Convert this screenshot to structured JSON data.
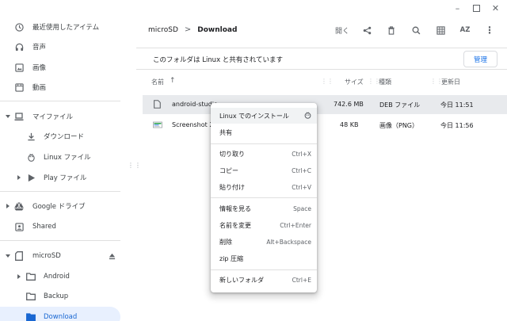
{
  "sidebar": {
    "items": [
      {
        "label": "最近使用したアイテム",
        "icon": "clock-icon"
      },
      {
        "label": "音声",
        "icon": "headphones-icon"
      },
      {
        "label": "画像",
        "icon": "image-icon"
      },
      {
        "label": "動画",
        "icon": "video-icon"
      },
      {
        "label": "マイファイル",
        "icon": "laptop-icon"
      },
      {
        "label": "ダウンロード",
        "icon": "download-icon"
      },
      {
        "label": "Linux ファイル",
        "icon": "linux-penguin-icon"
      },
      {
        "label": "Play ファイル",
        "icon": "play-icon"
      },
      {
        "label": "Google ドライブ",
        "icon": "drive-icon"
      },
      {
        "label": "Shared",
        "icon": "shared-folder-icon"
      },
      {
        "label": "microSD",
        "icon": "sd-card-icon"
      },
      {
        "label": "Android",
        "icon": "folder-icon"
      },
      {
        "label": "Backup",
        "icon": "folder-icon"
      },
      {
        "label": "Download",
        "icon": "folder-icon"
      }
    ]
  },
  "breadcrumb": {
    "parent": "microSD",
    "separator": ">",
    "current": "Download"
  },
  "toolbar": {
    "open_label": "開く",
    "sort_label": "AZ"
  },
  "share_bar": {
    "text": "このフォルダは Linux と共有されています",
    "manage_label": "管理"
  },
  "columns": {
    "name": "名前",
    "sort_arrow": "↑",
    "size": "サイズ",
    "type": "種類",
    "modified": "更新日"
  },
  "files": [
    {
      "name": "android-studio",
      "size": "742.6 MB",
      "type": "DEB ファイル",
      "modified": "今日 11:51",
      "icon": "file-icon"
    },
    {
      "name": "Screenshot 20",
      "size": "48 KB",
      "type": "画像（PNG）",
      "modified": "今日 11:56",
      "icon": "image-file-icon"
    }
  ],
  "context_menu": {
    "install_linux": "Linux でのインストール",
    "share": "共有",
    "cut": "切り取り",
    "cut_shortcut": "Ctrl+X",
    "copy": "コピー",
    "copy_shortcut": "Ctrl+C",
    "paste": "貼り付け",
    "paste_shortcut": "Ctrl+V",
    "info": "情報を見る",
    "info_shortcut": "Space",
    "rename": "名前を変更",
    "rename_shortcut": "Ctrl+Enter",
    "delete": "削除",
    "delete_shortcut": "Alt+Backspace",
    "zip": "zip 圧縮",
    "new_folder": "新しいフォルダ",
    "new_folder_shortcut": "Ctrl+E"
  },
  "colors": {
    "accent": "#1a73e8",
    "active_bg": "#e8f0fe",
    "selected_row": "#e8eaed"
  }
}
